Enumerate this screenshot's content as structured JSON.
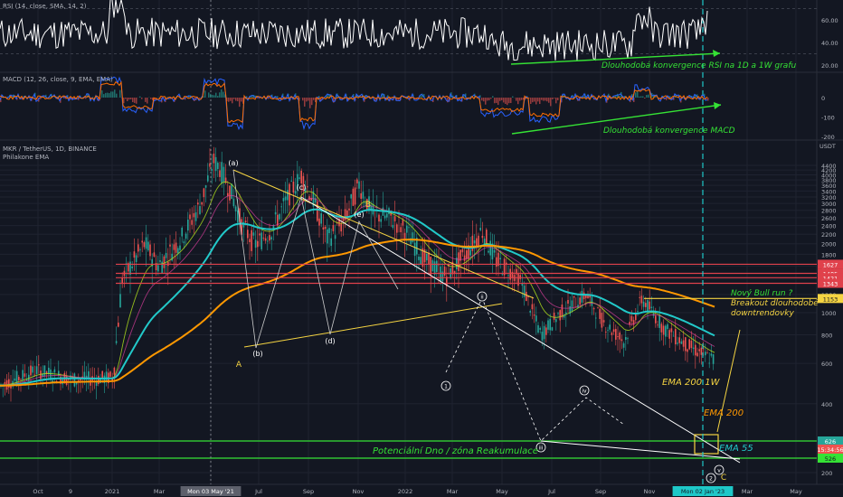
{
  "colors": {
    "background": "#131722",
    "grid": "#1f2330",
    "axis_text": "#b2b5be",
    "up": "#26a69a",
    "down": "#ef5350",
    "rsi": "#ffffff",
    "macd": "#2962ff",
    "signal": "#ff6d00",
    "ema_cyan": "#22c9c9",
    "ema_orange": "#ff9800",
    "yellow_line": "#f5d442",
    "green_line": "#35e235",
    "red_line": "#e0414b",
    "cyan_dash": "#1ec8c8"
  },
  "panels": {
    "rsi_label": "RSI (14, close, SMA, 14, 2)",
    "macd_label": "MACD (12, 26, close, 9, EMA, EMA)",
    "price_label": "MKR / TetherUS, 1D, BINANCE",
    "price_sublabel": "Philakone EMA"
  },
  "annotations": {
    "rsi_conv": "Dlouhodobá konvergence RSI na 1D a 1W grafu",
    "macd_conv": "Dlouhodobá konvergence MACD",
    "bull_run": [
      "Nový Bull run ?",
      "Breakout dlouhodobé",
      "downtrendovky"
    ],
    "ema200w": "EMA 200 1W",
    "ema200": "EMA 200",
    "ema55": "EMA 55",
    "dno": "Potenciální Dno / zóna Reakumulace"
  },
  "wave_labels": {
    "a": "(a)",
    "b": "(b)",
    "c": "(c)",
    "d": "(d)",
    "e": "(e)",
    "A": "A",
    "B": "B",
    "C": "C",
    "i": "i",
    "ii": "ii",
    "iii": "iii",
    "iv": "iv",
    "v": "v",
    "one": "1",
    "two": "2"
  },
  "x_axis": {
    "ticks": [
      "Oct",
      "9",
      "2021",
      "Mar",
      "Mon 03 May '21",
      "Jul",
      "Sep",
      "Nov",
      "2022",
      "Mar",
      "May",
      "Jul",
      "Sep",
      "Nov",
      "Mon 02 Jan '23",
      "Mar",
      "May"
    ]
  },
  "chart_data": {
    "type": "line",
    "y_axis_unit": "USDT",
    "price_ticks": [
      "4400",
      "4200",
      "4000",
      "3800",
      "3600",
      "3400",
      "3200",
      "3000",
      "2800",
      "2600",
      "2400",
      "2200",
      "2000",
      "1800",
      "1600",
      "1400",
      "1200",
      "1000",
      "800",
      "600",
      "400",
      "200"
    ],
    "price_labels": {
      "red_1": "1627",
      "red_2": "1485",
      "red_3": "1421",
      "red_4": "1343",
      "yellow": "1153",
      "current": "626",
      "countdown": "15:34:56",
      "green": "526"
    },
    "horizontal_levels": [
      1627,
      1485,
      1421,
      1343,
      1153
    ],
    "rsi": {
      "ticks": [
        "60.00",
        "40.00",
        "20.00"
      ],
      "ylim": [
        15,
        75
      ]
    },
    "macd": {
      "ticks": [
        "0",
        "-100",
        "-200"
      ],
      "ylim": [
        -230,
        110
      ]
    },
    "price_approx": {
      "date": [
        "2020-10",
        "2021-01",
        "2021-02",
        "2021-03",
        "2021-05-03",
        "2021-07",
        "2021-09",
        "2021-11",
        "2022-01",
        "2022-03",
        "2022-05",
        "2022-07",
        "2022-09",
        "2022-11",
        "2023-01"
      ],
      "close": [
        560,
        520,
        1400,
        2000,
        5900,
        2100,
        4000,
        3000,
        2500,
        1500,
        1900,
        850,
        1250,
        740,
        626
      ]
    }
  }
}
